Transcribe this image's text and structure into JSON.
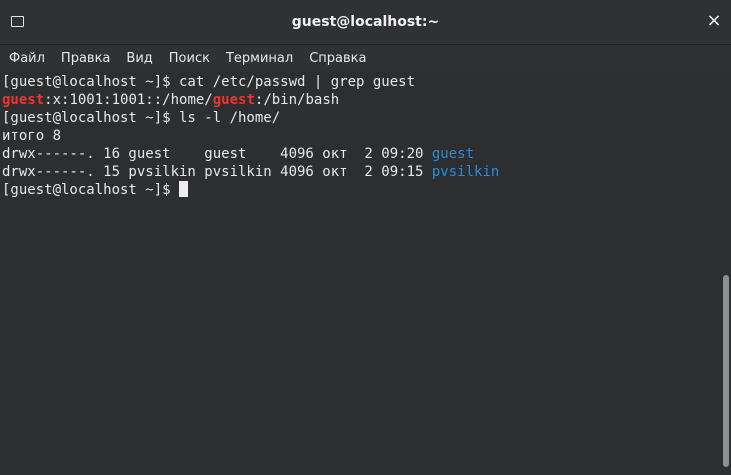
{
  "window": {
    "title": "guest@localhost:~",
    "close_glyph": "×"
  },
  "menu": {
    "items": [
      "Файл",
      "Правка",
      "Вид",
      "Поиск",
      "Терминал",
      "Справка"
    ]
  },
  "terminal": {
    "line1": "[guest@localhost ~]$ cat /etc/passwd | grep guest",
    "line2": {
      "m1": "guest",
      "t1": ":x:1001:1001::/home/",
      "m2": "guest",
      "t2": ":/bin/bash"
    },
    "line3": "[guest@localhost ~]$ ls -l /home/",
    "line4": "итого 8",
    "line5": {
      "prefix": "drwx------. 16 guest    guest    4096 окт  2 09:20 ",
      "dir": "guest"
    },
    "line6": {
      "prefix": "drwx------. 15 pvsilkin pvsilkin 4096 окт  2 09:15 ",
      "dir": "pvsilkin"
    },
    "line7": "[guest@localhost ~]$ "
  },
  "colors": {
    "match_highlight": "#ee3333",
    "directory": "#2a8be0",
    "background": "#2c2e30",
    "foreground": "#e8e8e8"
  },
  "icons": {
    "titlebar": "terminal-icon",
    "close": "close-icon"
  },
  "scrollbar": {
    "position_fraction": 0.5,
    "visible_fraction": 0.48
  }
}
